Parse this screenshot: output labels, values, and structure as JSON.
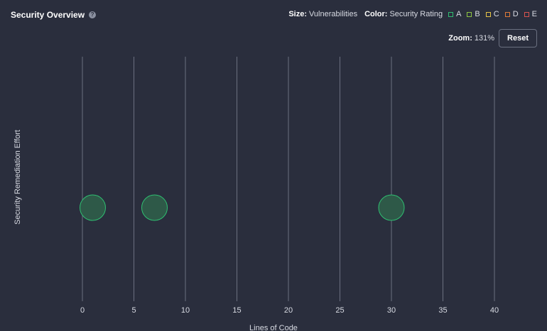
{
  "header": {
    "title": "Security Overview",
    "help_icon": "?",
    "size_label": "Size:",
    "size_value": "Vulnerabilities",
    "color_label": "Color:",
    "color_value": "Security Rating",
    "zoom_label": "Zoom:",
    "zoom_value": "131%",
    "reset_label": "Reset"
  },
  "legend": [
    {
      "label": "A",
      "color": "#2fbf71"
    },
    {
      "label": "B",
      "color": "#8ec641"
    },
    {
      "label": "C",
      "color": "#e8c547"
    },
    {
      "label": "D",
      "color": "#e07b39"
    },
    {
      "label": "E",
      "color": "#d9534f"
    }
  ],
  "chart_data": {
    "type": "scatter",
    "xlabel": "Lines of Code",
    "ylabel": "Security Remediation Effort",
    "xlim": [
      0,
      40
    ],
    "xticks": [
      0,
      5,
      10,
      15,
      20,
      25,
      30,
      35,
      40
    ],
    "grid": true,
    "points": [
      {
        "x": 1,
        "y": 0,
        "rating": "A"
      },
      {
        "x": 7,
        "y": 0,
        "rating": "A"
      },
      {
        "x": 30,
        "y": 0,
        "rating": "A"
      }
    ]
  },
  "colors": {
    "background": "#2a2e3d",
    "grid": "#6b7080",
    "bubble_fill": "#2e5948",
    "bubble_stroke": "#2fbf71"
  }
}
